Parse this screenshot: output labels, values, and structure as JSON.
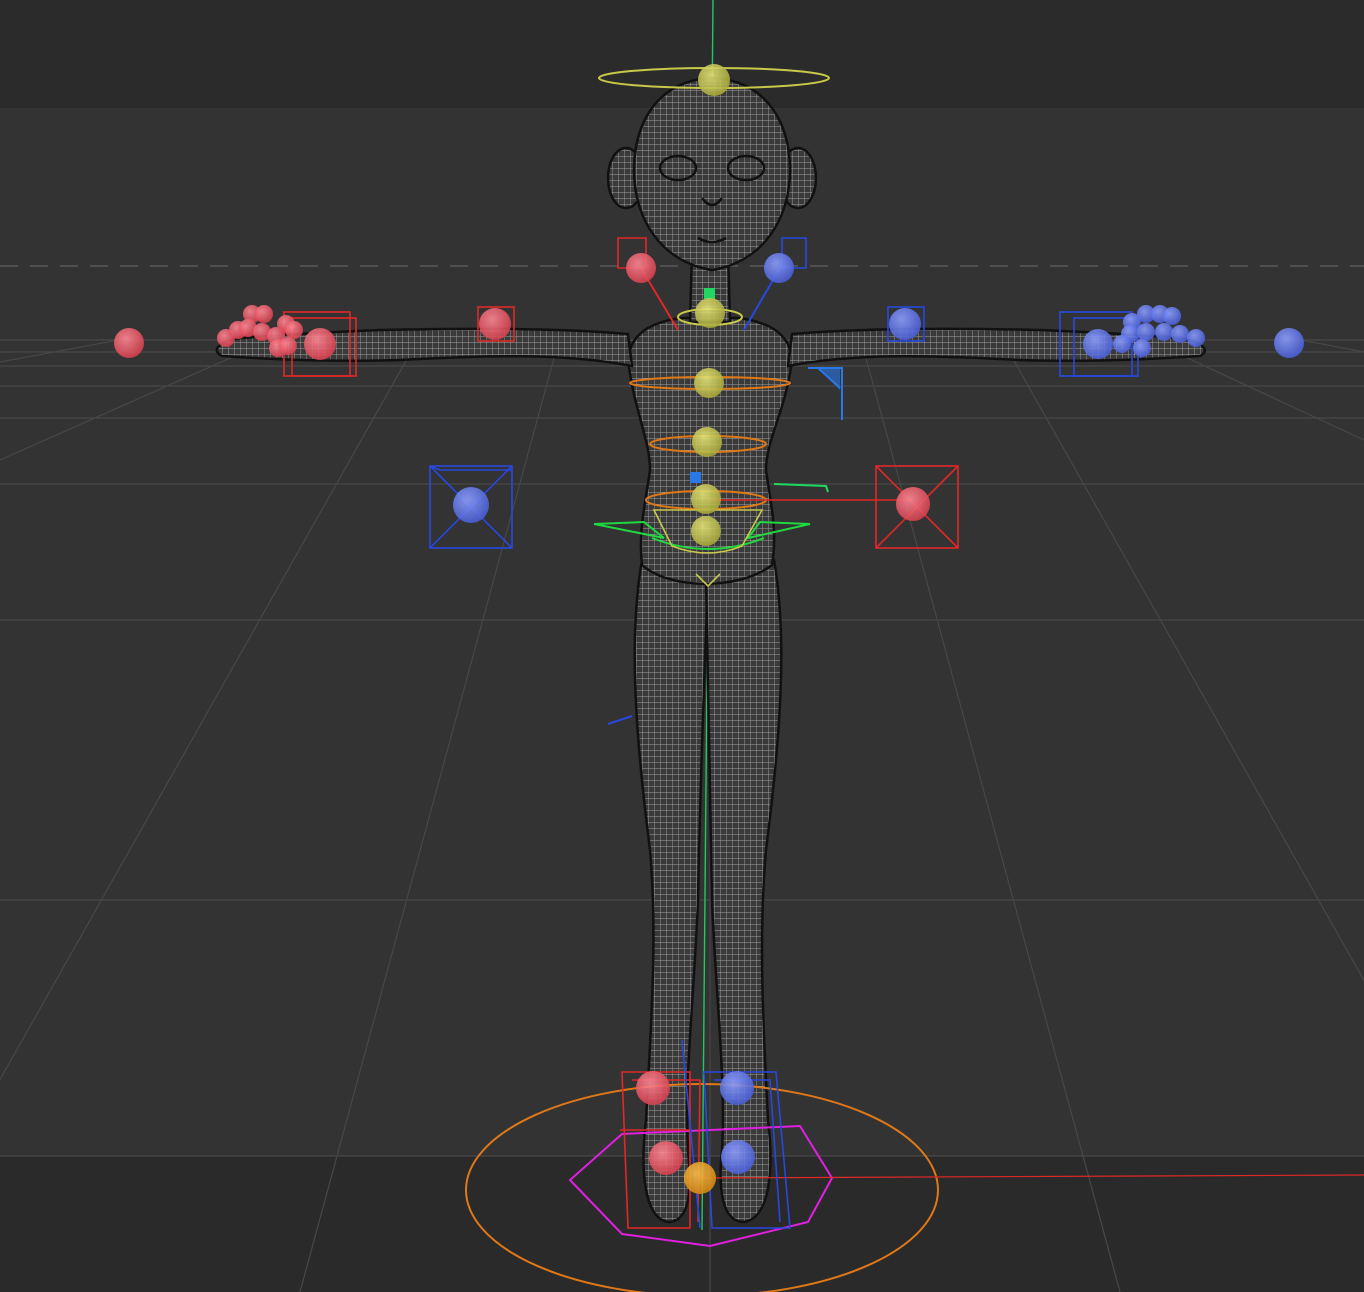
{
  "viewport": {
    "background": "#2b2b2b",
    "floor_color": "#323232",
    "grid_color": "#474747",
    "horizon_color": "#5a5a5a",
    "mesh_color": "#3a3a3a",
    "mesh_line_color": "#9c9c9c"
  },
  "rig": {
    "left_side_color": "#e84a5a",
    "right_side_color": "#5a6ee8",
    "center_color": "#c8c84a",
    "root_color": "#f0a020",
    "ring_color": "#e07818",
    "foot_ring_color": "#e020e0",
    "axis_y_color": "#20d860",
    "axis_x_color": "#e02828",
    "axis_z_color": "#2848e0"
  }
}
